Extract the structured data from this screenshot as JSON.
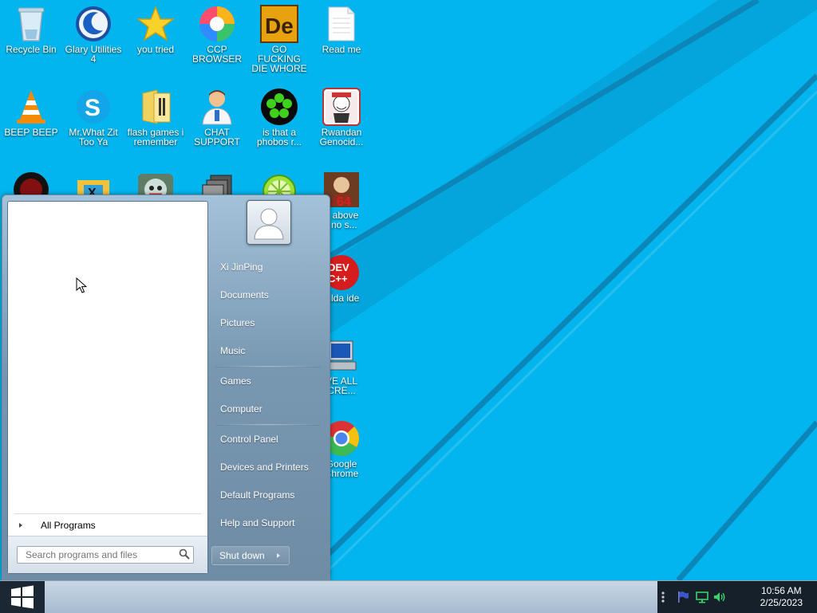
{
  "desktop": {
    "icons": [
      {
        "label": "Recycle Bin",
        "icon": "recycle-bin-icon"
      },
      {
        "label": "Glary Utilities\n4",
        "icon": "glary-utilities-icon"
      },
      {
        "label": "you tried",
        "icon": "gold-star-icon"
      },
      {
        "label": "CCP\nBROWSER",
        "icon": "browser-swirl-icon"
      },
      {
        "label": "GO FUCKING\nDIE WHORE",
        "icon": "dreamweaver-de-icon"
      },
      {
        "label": "Read me",
        "icon": "text-file-icon"
      },
      {
        "label": "BEEP BEEP",
        "icon": "vlc-cone-icon"
      },
      {
        "label": "Mr.What Zit\nToo Ya",
        "icon": "skype-icon"
      },
      {
        "label": "flash games i\nremember",
        "icon": "folder-icon"
      },
      {
        "label": "CHAT\nSUPPORT",
        "icon": "doctor-person-icon"
      },
      {
        "label": "is that a\nphobos r...",
        "icon": "green-flower-icon"
      },
      {
        "label": "Rwandan\nGenocid...",
        "icon": "meme-face-icon"
      },
      {
        "label": "",
        "icon": "red-black-circle-icon"
      },
      {
        "label": "",
        "icon": "hex-game-icon"
      },
      {
        "label": "",
        "icon": "skull-face-icon"
      },
      {
        "label": "",
        "icon": "stacked-windows-icon"
      },
      {
        "label": "",
        "icon": "lime-icon"
      },
      {
        "label": "e above\nt no s...",
        "icon": "painting-64-icon"
      },
      {
        "label": "hilda ide",
        "icon": "dev-cpp-icon"
      },
      {
        "label": "VE ALL\nCRE...",
        "icon": "computer-icon"
      },
      {
        "label": "Google\nChrome",
        "icon": "chrome-icon"
      }
    ]
  },
  "start_menu": {
    "user_name": "Xi JinPing",
    "right_items": [
      "Documents",
      "Pictures",
      "Music",
      "Games",
      "Computer",
      "Control Panel",
      "Devices and Printers",
      "Default Programs",
      "Help and Support"
    ],
    "all_programs": "All Programs",
    "search_placeholder": "Search programs and files",
    "shutdown": "Shut down"
  },
  "taskbar": {
    "time": "10:56 AM",
    "date": "2/25/2023"
  },
  "colors": {
    "desktop": "#02b5ee",
    "tray": "#16202a"
  }
}
